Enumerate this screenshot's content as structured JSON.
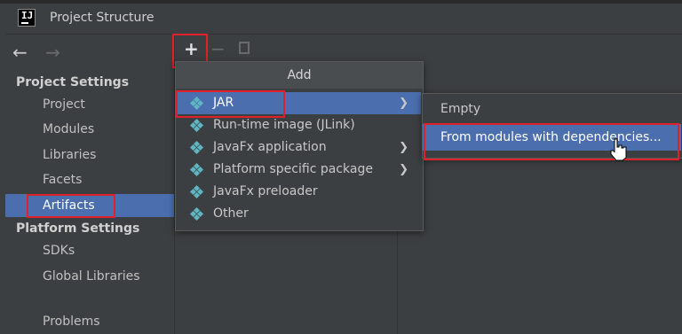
{
  "window": {
    "title": "Project Structure",
    "logo_text": "IJ"
  },
  "sidebar": {
    "back_icon": "←",
    "forward_icon": "→",
    "project_settings_header": "Project Settings",
    "project_items": [
      "Project",
      "Modules",
      "Libraries",
      "Facets",
      "Artifacts"
    ],
    "platform_settings_header": "Platform Settings",
    "platform_items": [
      "SDKs",
      "Global Libraries"
    ],
    "problems": "Problems",
    "selected": "Artifacts"
  },
  "toolbar": {
    "add_icon": "+",
    "remove_icon": "−",
    "copy_icon": "copy-icon"
  },
  "popup": {
    "title": "Add",
    "items": [
      {
        "label": "JAR",
        "submenu": true,
        "chevron": "❯",
        "active": true
      },
      {
        "label": "Run-time image (JLink)",
        "submenu": false
      },
      {
        "label": "JavaFx application",
        "submenu": true,
        "chevron": "❯"
      },
      {
        "label": "Platform specific package",
        "submenu": true,
        "chevron": "❯"
      },
      {
        "label": "JavaFx preloader",
        "submenu": false
      },
      {
        "label": "Other",
        "submenu": false
      }
    ]
  },
  "submenu": {
    "items": [
      {
        "label": "Empty"
      },
      {
        "label": "From modules with dependencies...",
        "active": true
      }
    ]
  },
  "colors": {
    "background": "#3c3f41",
    "selection": "#4b6eaf",
    "highlight": "#e0202a",
    "icon": "#5fb5c2"
  }
}
